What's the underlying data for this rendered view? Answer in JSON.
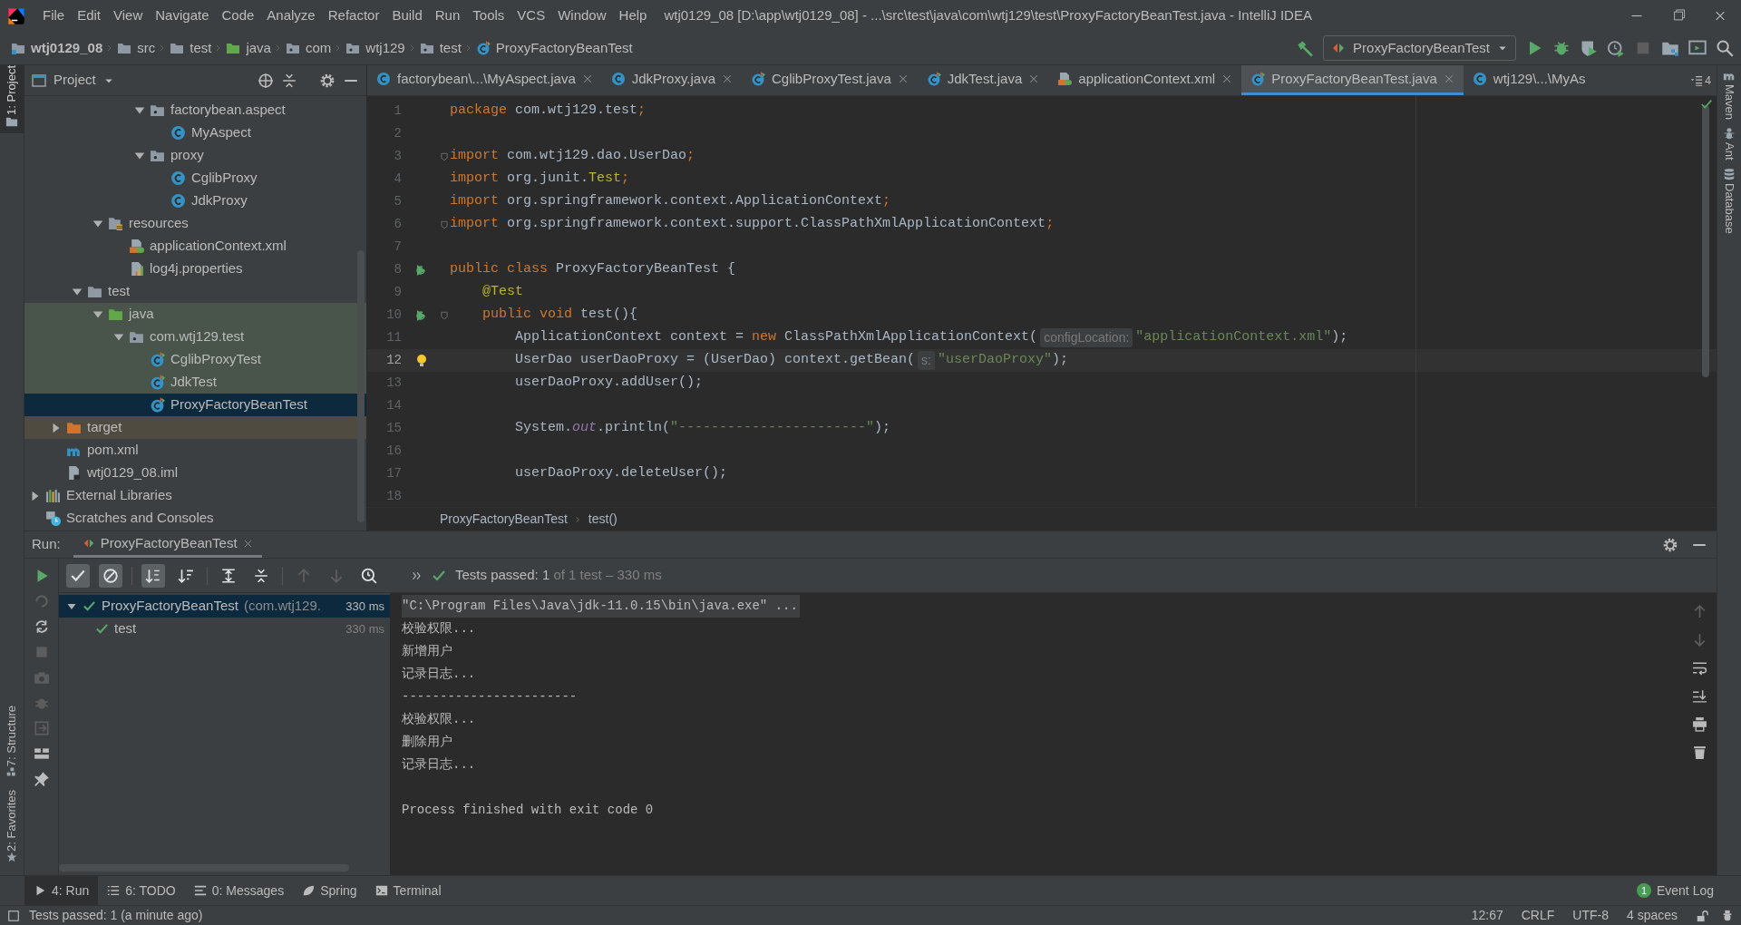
{
  "menu": [
    "File",
    "Edit",
    "View",
    "Navigate",
    "Code",
    "Analyze",
    "Refactor",
    "Build",
    "Run",
    "Tools",
    "VCS",
    "Window",
    "Help"
  ],
  "window": {
    "title": "wtj0129_08 [D:\\app\\wtj0129_08] - ...\\src\\test\\java\\com\\wtj129\\test\\ProxyFactoryBeanTest.java - IntelliJ IDEA"
  },
  "navbar": {
    "crumbs": [
      {
        "label": "wtj0129_08",
        "kind": "module"
      },
      {
        "label": "src",
        "kind": "folder"
      },
      {
        "label": "test",
        "kind": "folder"
      },
      {
        "label": "java",
        "kind": "folder-green"
      },
      {
        "label": "com",
        "kind": "package"
      },
      {
        "label": "wtj129",
        "kind": "package"
      },
      {
        "label": "test",
        "kind": "package"
      },
      {
        "label": "ProxyFactoryBeanTest",
        "kind": "test-class"
      }
    ],
    "run_config": "ProxyFactoryBeanTest"
  },
  "left_stripe": [
    {
      "label": "1: Project",
      "selected": true
    },
    {
      "label": "7: Structure",
      "selected": false
    },
    {
      "label": "2: Favorites",
      "selected": false
    }
  ],
  "right_stripe": [
    "Maven",
    "Ant",
    "Database"
  ],
  "project_panel": {
    "title": "Project",
    "tree": [
      {
        "children": [
          {
            "children": [
              {
                "children": [
                  {
                    "children": [
                      {
                        "children": [
                          {
                            "label": "factorybean.aspect",
                            "kind": "package",
                            "expanded": true,
                            "selected": false,
                            "children": [
                              {
                                "label": "MyAspect",
                                "kind": "class",
                                "selected": false
                              }
                            ]
                          },
                          {
                            "label": "proxy",
                            "kind": "package",
                            "expanded": true,
                            "selected": false,
                            "children": [
                              {
                                "label": "CglibProxy",
                                "kind": "class",
                                "selected": false
                              },
                              {
                                "label": "JdkProxy",
                                "kind": "class",
                                "selected": false
                              }
                            ]
                          }
                        ]
                      }
                    ]
                  },
                  {
                    "label": "resources",
                    "kind": "resources",
                    "expanded": true,
                    "selected": false,
                    "children": [
                      {
                        "label": "applicationContext.xml",
                        "kind": "xml",
                        "selected": false
                      },
                      {
                        "label": "log4j.properties",
                        "kind": "properties",
                        "selected": false
                      }
                    ]
                  }
                ]
              },
              {
                "label": "test",
                "kind": "folder",
                "expanded": true,
                "selected": false,
                "children": [
                  {
                    "label": "java",
                    "kind": "folder-green",
                    "expanded": true,
                    "selected": false,
                    "test_source": true,
                    "children": [
                      {
                        "label": "com.wtj129.test",
                        "kind": "package",
                        "expanded": true,
                        "selected": false,
                        "test_source": true,
                        "children": [
                          {
                            "label": "CglibProxyTest",
                            "kind": "test-class",
                            "selected": false,
                            "test_source": true
                          },
                          {
                            "label": "JdkTest",
                            "kind": "test-class",
                            "selected": false,
                            "test_source": true
                          },
                          {
                            "label": "ProxyFactoryBeanTest",
                            "kind": "test-class",
                            "selected": true
                          }
                        ]
                      }
                    ]
                  }
                ]
              }
            ]
          },
          {
            "label": "target",
            "kind": "folder-orange",
            "expanded": false,
            "selected": false,
            "excluded": true
          },
          {
            "label": "pom.xml",
            "kind": "maven",
            "selected": false
          },
          {
            "label": "wtj0129_08.iml",
            "kind": "iml",
            "selected": false
          }
        ]
      },
      {
        "label": "External Libraries",
        "kind": "libraries",
        "expanded": false,
        "selected": false
      },
      {
        "label": "Scratches and Consoles",
        "kind": "scratches",
        "selected": false
      }
    ]
  },
  "editor_tabs": [
    {
      "label": "factorybean\\...\\MyAspect.java",
      "kind": "class",
      "selected": false,
      "closable": true
    },
    {
      "label": "JdkProxy.java",
      "kind": "class",
      "selected": false,
      "closable": true
    },
    {
      "label": "CglibProxyTest.java",
      "kind": "test-class",
      "selected": false,
      "closable": true
    },
    {
      "label": "JdkTest.java",
      "kind": "test-class",
      "selected": false,
      "closable": true
    },
    {
      "label": "applicationContext.xml",
      "kind": "xml",
      "selected": false,
      "closable": true
    },
    {
      "label": "ProxyFactoryBeanTest.java",
      "kind": "test-class",
      "selected": true,
      "closable": true
    },
    {
      "label": "wtj129\\...\\MyAs",
      "kind": "class",
      "selected": false,
      "closable": false
    }
  ],
  "hidden_tabs_count": "4",
  "code": [
    {
      "number": "1",
      "tokens": [
        {
          "kind": "kw",
          "text": "package"
        },
        {
          "kind": "plain",
          "text": " com.wtj129.test"
        },
        {
          "kind": "kw",
          "text": ";"
        }
      ]
    },
    {
      "number": "2"
    },
    {
      "number": "3",
      "fold": true,
      "tokens": [
        {
          "kind": "kw",
          "text": "import"
        },
        {
          "kind": "plain",
          "text": " com.wtj129.dao.UserDao"
        },
        {
          "kind": "kw",
          "text": ";"
        }
      ]
    },
    {
      "number": "4",
      "tokens": [
        {
          "kind": "kw",
          "text": "import"
        },
        {
          "kind": "plain",
          "text": " org.junit."
        },
        {
          "kind": "ann",
          "text": "Test"
        },
        {
          "kind": "kw",
          "text": ";"
        }
      ]
    },
    {
      "number": "5",
      "tokens": [
        {
          "kind": "kw",
          "text": "import"
        },
        {
          "kind": "plain",
          "text": " org.springframework.context.ApplicationContext"
        },
        {
          "kind": "kw",
          "text": ";"
        }
      ]
    },
    {
      "number": "6",
      "fold": true,
      "tokens": [
        {
          "kind": "kw",
          "text": "import"
        },
        {
          "kind": "plain",
          "text": " org.springframework.context.support.ClassPathXmlApplicationContext"
        },
        {
          "kind": "kw",
          "text": ";"
        }
      ]
    },
    {
      "number": "7"
    },
    {
      "number": "8",
      "run_marker": true,
      "tokens": [
        {
          "kind": "kw",
          "text": "public class"
        },
        {
          "kind": "plain",
          "text": " ProxyFactoryBeanTest {"
        }
      ]
    },
    {
      "number": "9",
      "tokens": [
        {
          "kind": "ann",
          "text": "    @Test"
        }
      ]
    },
    {
      "number": "10",
      "run_marker": true,
      "fold": true,
      "tokens": [
        {
          "kind": "kw",
          "text": "    public void"
        },
        {
          "kind": "plain",
          "text": " test(){"
        }
      ]
    },
    {
      "number": "11",
      "tokens": [
        {
          "kind": "plain",
          "text": "        ApplicationContext context = "
        },
        {
          "kind": "kw",
          "text": "new"
        },
        {
          "kind": "plain",
          "text": " ClassPathXmlApplicationContext("
        },
        {
          "kind": "hint",
          "text": "configLocation:"
        },
        {
          "kind": "str",
          "text": "\"applicationContext.xml\""
        },
        {
          "kind": "plain",
          "text": ");"
        }
      ]
    },
    {
      "number": "12",
      "current": true,
      "bulb": true,
      "tokens": [
        {
          "kind": "plain",
          "text": "        UserDao userDaoProxy = (UserDao) context.getBean("
        },
        {
          "kind": "hint",
          "text": "s:"
        },
        {
          "kind": "str",
          "text": "\"userDaoProxy\""
        },
        {
          "kind": "plain",
          "text": ");"
        }
      ]
    },
    {
      "number": "13",
      "tokens": [
        {
          "kind": "plain",
          "text": "        userDaoProxy.addUser();"
        }
      ]
    },
    {
      "number": "14"
    },
    {
      "number": "15",
      "tokens": [
        {
          "kind": "plain",
          "text": "        System."
        },
        {
          "kind": "field",
          "text": "out"
        },
        {
          "kind": "plain",
          "text": ".println("
        },
        {
          "kind": "str",
          "text": "\"-----------------------\""
        },
        {
          "kind": "plain",
          "text": ");"
        }
      ]
    },
    {
      "number": "16"
    },
    {
      "number": "17",
      "tokens": [
        {
          "kind": "plain",
          "text": "        userDaoProxy.deleteUser();"
        }
      ]
    },
    {
      "number": "18"
    }
  ],
  "editor_breadcrumb": [
    "ProxyFactoryBeanTest",
    "test()"
  ],
  "run_panel": {
    "label": "Run:",
    "tab": "ProxyFactoryBeanTest",
    "status": "Tests passed: 1",
    "status_detail": "of 1 test – 330 ms",
    "tests": [
      {
        "name": "ProxyFactoryBeanTest",
        "qualifier": "(com.wtj129.",
        "time": "330 ms",
        "passed": true,
        "selected": true,
        "expanded": true,
        "children": [
          {
            "name": "test",
            "time": "330 ms",
            "passed": true,
            "selected": false
          }
        ]
      }
    ],
    "console": [
      {
        "kind": "command",
        "text": "\"C:\\Program Files\\Java\\jdk-11.0.15\\bin\\java.exe\" ..."
      },
      {
        "kind": "output",
        "text": "校验权限..."
      },
      {
        "kind": "output",
        "text": "新增用户"
      },
      {
        "kind": "output",
        "text": "记录日志..."
      },
      {
        "kind": "output",
        "text": "-----------------------"
      },
      {
        "kind": "output",
        "text": "校验权限..."
      },
      {
        "kind": "output",
        "text": "删除用户"
      },
      {
        "kind": "output",
        "text": "记录日志..."
      },
      {
        "kind": "blank"
      },
      {
        "kind": "output",
        "text": "Process finished with exit code 0"
      }
    ]
  },
  "tool_windows": [
    {
      "label": "4: Run",
      "kind": "run",
      "selected": true
    },
    {
      "label": "6: TODO",
      "kind": "list",
      "selected": false
    },
    {
      "label": "0: Messages",
      "kind": "messages",
      "selected": false
    },
    {
      "label": "Spring",
      "kind": "leaf",
      "selected": false
    },
    {
      "label": "Terminal",
      "kind": "terminal",
      "selected": false
    }
  ],
  "event_log": {
    "label": "Event Log",
    "count": "1"
  },
  "status_bar": {
    "message": "Tests passed: 1 (a minute ago)",
    "position": "12:67",
    "line_separator": "CRLF",
    "encoding": "UTF-8",
    "indent": "4 spaces"
  }
}
